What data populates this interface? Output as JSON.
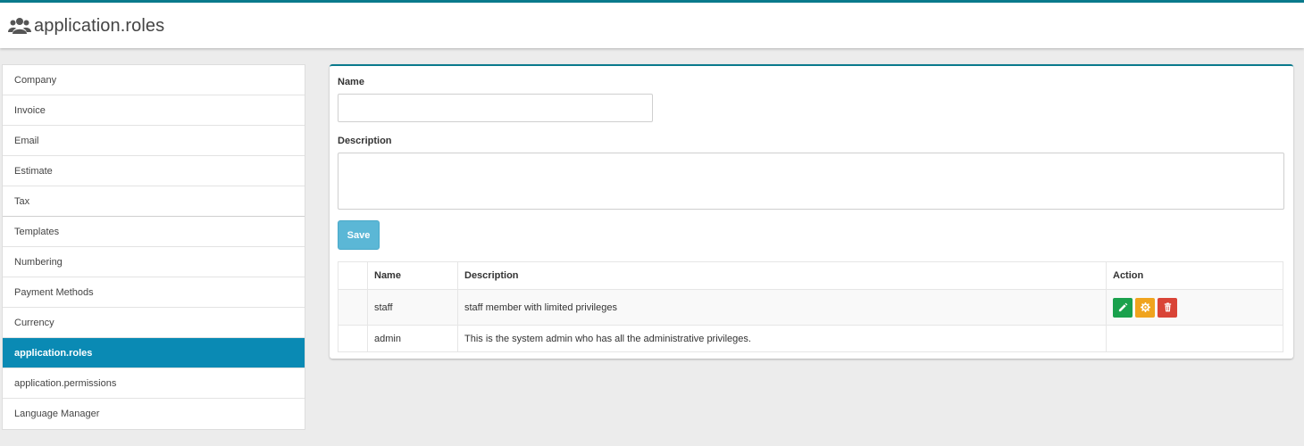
{
  "header": {
    "title": "application.roles",
    "icon": "users-icon"
  },
  "sidebar": {
    "items": [
      {
        "label": "Company"
      },
      {
        "label": "Invoice"
      },
      {
        "label": "Email"
      },
      {
        "label": "Estimate"
      },
      {
        "label": "Tax"
      },
      {
        "label": "Templates"
      },
      {
        "label": "Numbering"
      },
      {
        "label": "Payment Methods"
      },
      {
        "label": "Currency"
      },
      {
        "label": "application.roles"
      },
      {
        "label": "application.permissions"
      },
      {
        "label": "Language Manager"
      }
    ],
    "active_index": 9
  },
  "form": {
    "name_label": "Name",
    "name_value": "",
    "description_label": "Description",
    "description_value": "",
    "save_label": "Save"
  },
  "table": {
    "headers": [
      "",
      "Name",
      "Description",
      "Action"
    ],
    "rows": [
      {
        "name": "staff",
        "description": "staff member with limited privileges",
        "actions": [
          "edit-icon",
          "gear-icon",
          "trash-icon"
        ]
      },
      {
        "name": "admin",
        "description": "This is the system admin who has all the administrative privileges.",
        "actions": []
      }
    ]
  },
  "colors": {
    "accent": "#0a7a8c",
    "active_item": "#0a8ab4",
    "save_button": "#5bb7d6",
    "edit_button": "#1aa14d",
    "permission_button": "#f0a41e",
    "delete_button": "#d94437"
  }
}
